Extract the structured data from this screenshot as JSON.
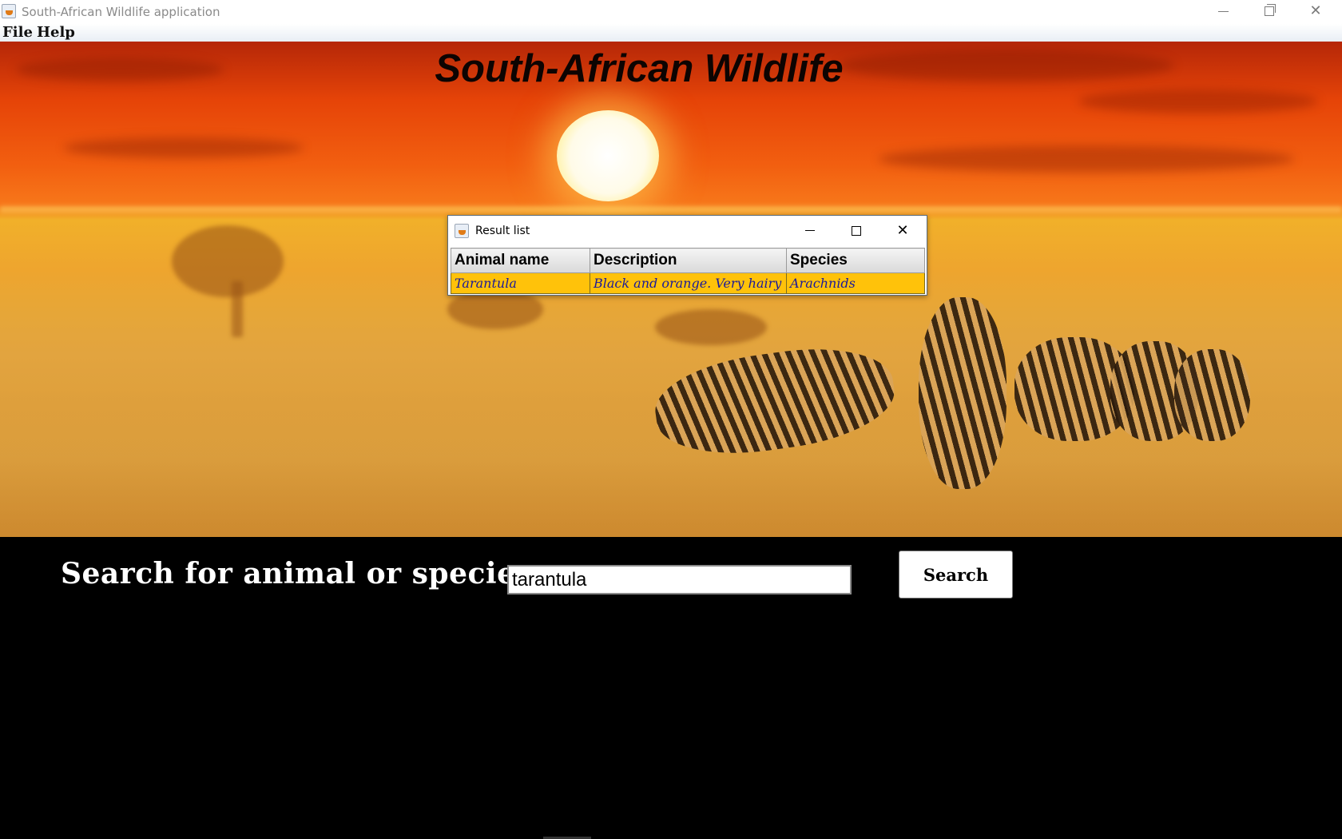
{
  "window": {
    "title": "South-African Wildlife application",
    "icon": "java-cup-icon"
  },
  "menubar": {
    "items": [
      {
        "label": "File"
      },
      {
        "label": "Help"
      }
    ]
  },
  "hero": {
    "title": "South-African Wildlife",
    "image_description_icon": "sunset-savanna-zebras-image"
  },
  "result_dialog": {
    "title": "Result list",
    "columns": [
      "Animal name",
      "Description",
      "Species"
    ],
    "rows": [
      {
        "animal_name": "Tarantula",
        "description": "Black and orange. Very hairy",
        "species": "Arachnids"
      }
    ],
    "row_highlight_color": "#ffc20a"
  },
  "search": {
    "label": "Search for animal or species :",
    "value": "tarantula",
    "button_label": "Search"
  }
}
